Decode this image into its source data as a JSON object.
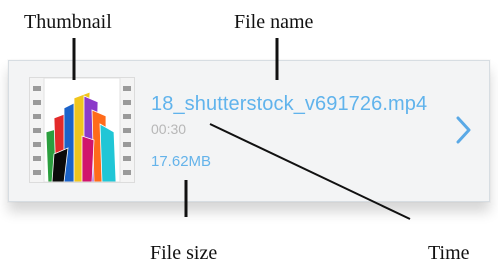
{
  "annotations": {
    "thumbnail": "Thumbnail",
    "file_name": "File name",
    "file_size": "File size",
    "time": "Time"
  },
  "item": {
    "file_name": "18_shutterstock_v691726.mp4",
    "duration": "00:30",
    "file_size": "17.62MB"
  },
  "icons": {
    "chevron": "chevron-right-icon"
  },
  "colors": {
    "accent": "#60b3ec",
    "muted_text": "#b7b7b7",
    "card_bg": "#f3f4f5"
  }
}
